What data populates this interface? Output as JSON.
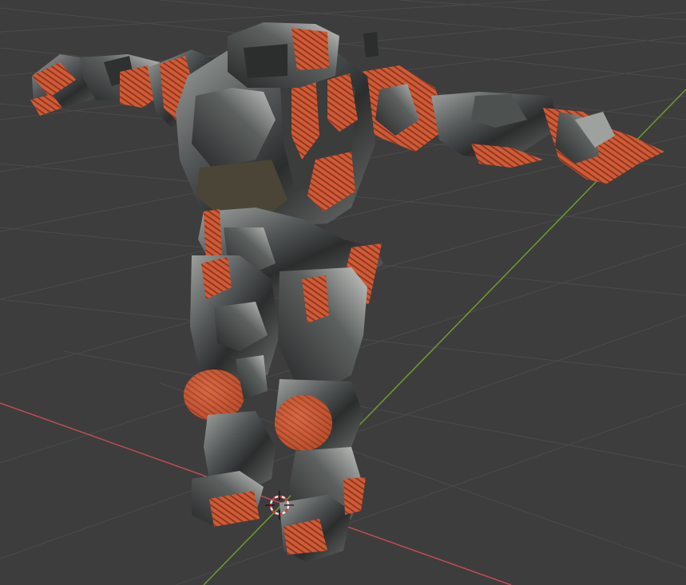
{
  "viewport": {
    "background": "#3d3d3d",
    "grid_color": "#4a4a4a",
    "x_axis_color": "#c24a55",
    "y_axis_color": "#6e9b2d"
  },
  "model": {
    "base_color": "#3e4140",
    "metal_highlight": "#b9bdb8",
    "accent_color": "#d25a36",
    "accent_dark": "#8e3a22"
  },
  "cursor": {
    "icon": "3d-cursor-icon",
    "ring_colors": [
      "#d63a3a",
      "#e8e8e8"
    ]
  }
}
